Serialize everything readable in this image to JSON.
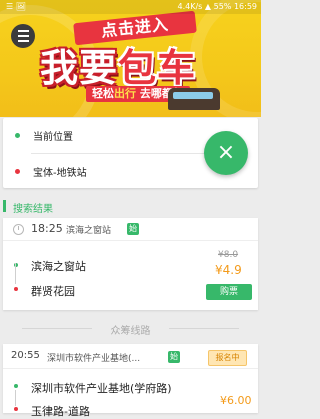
{
  "status_bar": {
    "left_text": "☰ 🖼",
    "speed": "4.4K/s",
    "battery": "55%",
    "time": "16:59"
  },
  "banner": {
    "top_text": "点击进入",
    "main_text_a": "我要",
    "main_text_b": "包车",
    "sub_text_a": "轻松",
    "sub_text_b": "出行",
    "sub_text_c": " 去哪都行"
  },
  "route": {
    "from": "当前位置",
    "to": "宝体-地铁站",
    "from_color": "#37b86a",
    "to_color": "#e8343f"
  },
  "swap_button": {
    "glyph": "×"
  },
  "search_results": {
    "section_label": "搜索结果",
    "item": {
      "time": "18:25",
      "stop": "滨海之窗站",
      "badge": "始",
      "from": "滨海之窗站",
      "to": "群贤花园",
      "old_price": "¥8.0",
      "new_price": "¥4.9",
      "buy_label": "购票"
    }
  },
  "crowd_routes": {
    "section_label": "众筹线路",
    "item": {
      "time": "20:55",
      "stop": "深圳市软件产业基地(...",
      "badge": "始",
      "status": "报名中",
      "from": "深圳市软件产业基地(学府路)",
      "to": "玉律路-道路",
      "price": "¥6.00"
    }
  },
  "colors": {
    "accent": "#37b86a",
    "price": "#f39a1a",
    "banner_red": "#e8343f",
    "banner_yellow": "#f7d21d"
  }
}
